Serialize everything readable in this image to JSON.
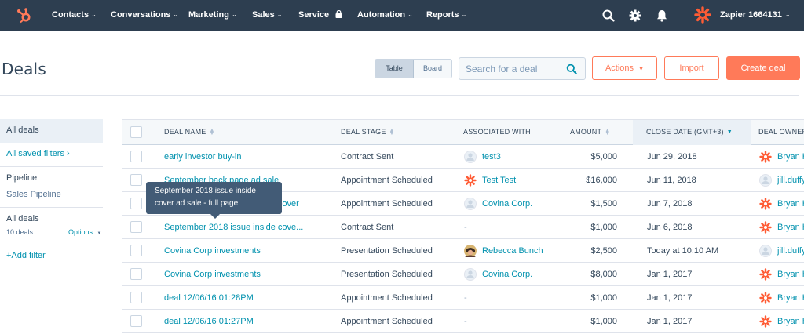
{
  "nav": {
    "items": [
      {
        "label": "Contacts",
        "chevron": true
      },
      {
        "label": "Conversations",
        "chevron": true
      },
      {
        "label": "Marketing",
        "chevron": true
      },
      {
        "label": "Sales",
        "chevron": true
      },
      {
        "label": "Service",
        "lock": true
      },
      {
        "label": "Automation",
        "chevron": true
      },
      {
        "label": "Reports",
        "chevron": true
      }
    ],
    "account": "Zapier 1664131",
    "icons": [
      "search-icon",
      "gear-icon",
      "bell-icon"
    ],
    "brand_color": "#ff7a59",
    "bar_color": "#2d3e50"
  },
  "header": {
    "title": "Deals",
    "view_toggle": {
      "table": "Table",
      "board": "Board",
      "selected": "Table"
    },
    "search_placeholder": "Search for a deal",
    "actions_label": "Actions",
    "import_label": "Import",
    "create_label": "Create deal"
  },
  "sidebar": {
    "all_deals": "All deals",
    "saved_filters": "All saved filters",
    "pipeline_heading": "Pipeline",
    "pipeline_value": "Sales Pipeline",
    "view_heading": "All deals",
    "count": "10 deals",
    "options": "Options",
    "add_filter": "+Add filter"
  },
  "table": {
    "columns": {
      "name": "DEAL NAME",
      "stage": "DEAL STAGE",
      "assoc": "ASSOCIATED WITH",
      "amount": "AMOUNT",
      "close": "CLOSE DATE (GMT+3)",
      "owner": "DEAL OWNER"
    },
    "rows": [
      {
        "name": "early investor buy-in",
        "stage": "Contract Sent",
        "assoc": "test3",
        "assoc_icon": "gray",
        "amount": "$5,000",
        "close": "Jun 29, 2018",
        "owner": "Bryan H",
        "owner_icon": "hubspot"
      },
      {
        "name": "September back page ad sale",
        "stage": "Appointment Scheduled",
        "assoc": "Test Test",
        "assoc_icon": "hubspot",
        "amount": "$16,000",
        "close": "Jun 11, 2018",
        "owner": "jill.duffy",
        "owner_icon": "gray"
      },
      {
        "name": "September 2018 issue inside cover",
        "stage": "Appointment Scheduled",
        "assoc": "Covina Corp.",
        "assoc_icon": "gray",
        "amount": "$1,500",
        "close": "Jun 7, 2018",
        "owner": "Bryan H",
        "owner_icon": "hubspot"
      },
      {
        "name": "September 2018 issue inside cove...",
        "stage": "Contract Sent",
        "assoc": "-",
        "assoc_icon": "none",
        "amount": "$1,000",
        "close": "Jun 6, 2018",
        "owner": "Bryan H",
        "owner_icon": "hubspot"
      },
      {
        "name": "Covina Corp investments",
        "stage": "Presentation Scheduled",
        "assoc": "Rebecca Bunch",
        "assoc_icon": "photo",
        "amount": "$2,500",
        "close": "Today at 10:10 AM",
        "owner": "jill.duffy",
        "owner_icon": "gray"
      },
      {
        "name": "Covina Corp investments",
        "stage": "Presentation Scheduled",
        "assoc": "Covina Corp.",
        "assoc_icon": "gray",
        "amount": "$8,000",
        "close": "Jan 1, 2017",
        "owner": "Bryan H",
        "owner_icon": "hubspot"
      },
      {
        "name": "deal 12/06/16 01:28PM",
        "stage": "Appointment Scheduled",
        "assoc": "-",
        "assoc_icon": "none",
        "amount": "$1,000",
        "close": "Jan 1, 2017",
        "owner": "Bryan H",
        "owner_icon": "hubspot"
      },
      {
        "name": "deal 12/06/16 01:27PM",
        "stage": "Appointment Scheduled",
        "assoc": "-",
        "assoc_icon": "none",
        "amount": "$1,000",
        "close": "Jan 1, 2017",
        "owner": "Bryan H",
        "owner_icon": "hubspot"
      }
    ]
  },
  "tooltip": {
    "line1": "September 2018 issue inside",
    "line2": "cover ad sale - full page"
  }
}
